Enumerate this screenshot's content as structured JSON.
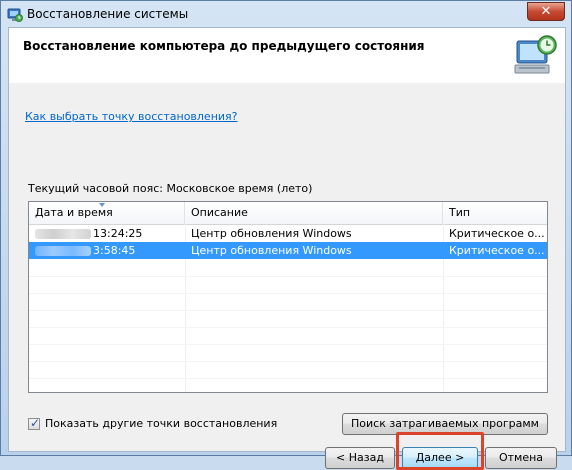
{
  "window": {
    "title": "Восстановление системы",
    "close_label": "✕",
    "icon": "system-restore-icon"
  },
  "header": {
    "title": "Восстановление компьютера до предыдущего состояния",
    "icon": "computer-restore-clock-icon"
  },
  "help_link": "Как выбрать точку восстановления?",
  "timezone_label": "Текущий часовой пояс: Московское время (лето)",
  "table": {
    "columns": [
      "Дата и время",
      "Описание",
      "Тип"
    ],
    "rows": [
      {
        "datetime": "13:24:25",
        "description": "Центр обновления Windows",
        "type": "Критическое о...",
        "selected": false
      },
      {
        "datetime": "3:58:45",
        "description": "Центр обновления Windows",
        "type": "Критическое о...",
        "selected": true
      }
    ]
  },
  "show_more": {
    "label": "Показать другие точки восстановления",
    "checked": true
  },
  "buttons": {
    "scan": "Поиск затрагиваемых программ",
    "back": "< Назад",
    "next": "Далее >",
    "cancel": "Отмена"
  },
  "colors": {
    "selection": "#3399ff",
    "link": "#0066cc",
    "highlight_frame": "#d9442a"
  }
}
